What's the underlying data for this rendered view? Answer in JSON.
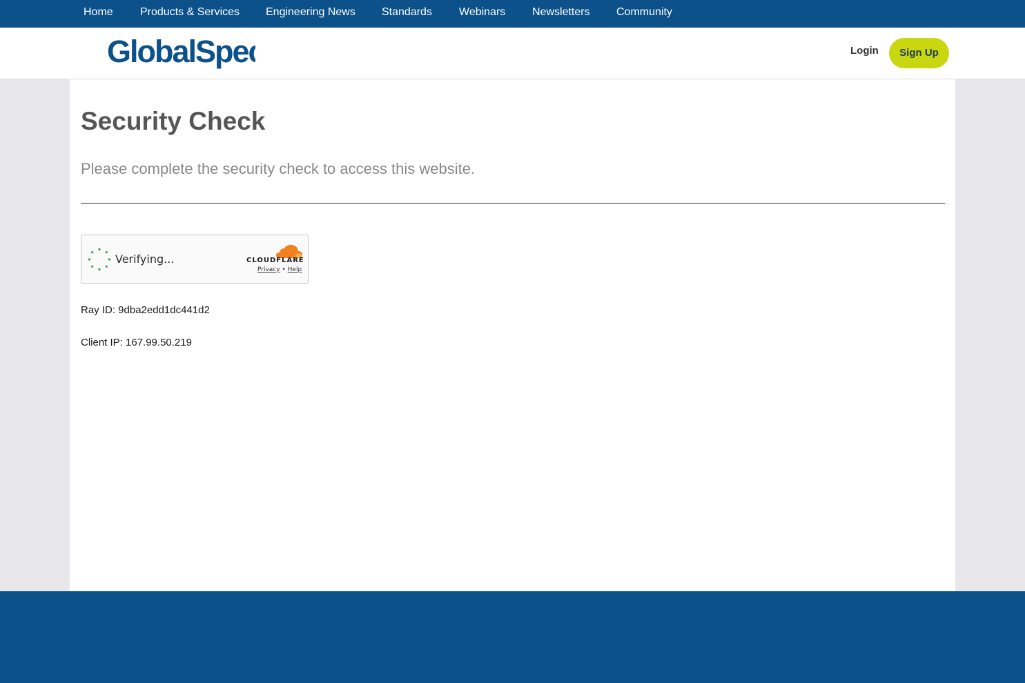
{
  "top_nav": {
    "items": [
      {
        "label": "Home"
      },
      {
        "label": "Products & Services"
      },
      {
        "label": "Engineering News"
      },
      {
        "label": "Standards"
      },
      {
        "label": "Webinars"
      },
      {
        "label": "Newsletters"
      },
      {
        "label": "Community"
      }
    ]
  },
  "header": {
    "logo_text": "GlobalSpec",
    "login_label": "Login",
    "signup_label": "Sign Up"
  },
  "main": {
    "title": "Security Check",
    "subtitle": "Please complete the security check to access this website.",
    "widget": {
      "status_text": "Verifying...",
      "brand_text": "CLOUDFLARE",
      "privacy_label": "Privacy",
      "separator": "•",
      "help_label": "Help",
      "spinner_icon": "loading-spinner-icon",
      "brand_icon": "cloudflare-cloud-icon"
    },
    "ray_id": "Ray ID: 9dba2edd1dc441d2",
    "client_ip": "Client IP: 167.99.50.219"
  },
  "colors": {
    "brand_blue": "#0c518a",
    "accent_lime": "#c8d70f",
    "cloudflare_orange": "#f38020",
    "spinner_green": "#2e9e4f"
  }
}
